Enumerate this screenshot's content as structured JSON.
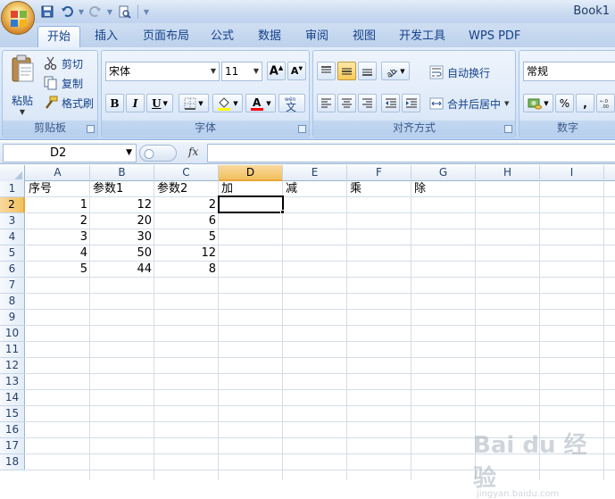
{
  "window": {
    "title": "Book1"
  },
  "tabs": [
    "开始",
    "插入",
    "页面布局",
    "公式",
    "数据",
    "审阅",
    "视图",
    "开发工具",
    "WPS PDF"
  ],
  "active_tab": "开始",
  "ribbon": {
    "clipboard": {
      "paste": "粘贴",
      "cut": "剪切",
      "copy": "复制",
      "format_painter": "格式刷",
      "label": "剪贴板"
    },
    "font": {
      "name": "宋体",
      "size": "11",
      "label": "字体",
      "bold": "B",
      "italic": "I",
      "underline": "U",
      "phonetic": "wén"
    },
    "alignment": {
      "wrap_text": "自动换行",
      "merge_center": "合并后居中",
      "label": "对齐方式"
    },
    "number": {
      "format": "常规",
      "percent": "%",
      "comma": ",",
      "label": "数字"
    }
  },
  "formula_bar": {
    "name_box": "D2",
    "fx": "fx",
    "formula": ""
  },
  "columns": [
    "A",
    "B",
    "C",
    "D",
    "E",
    "F",
    "G",
    "H",
    "I"
  ],
  "selected_column": "D",
  "rows": [
    "1",
    "2",
    "3",
    "4",
    "5",
    "6",
    "7",
    "8",
    "9",
    "10",
    "11",
    "12",
    "13",
    "14",
    "15",
    "16",
    "17",
    "18"
  ],
  "selected_row": "2",
  "sheet": {
    "header": [
      "序号",
      "参数1",
      "参数2",
      "加",
      "减",
      "乘",
      "除"
    ],
    "data": [
      [
        "1",
        "12",
        "2"
      ],
      [
        "2",
        "20",
        "6"
      ],
      [
        "3",
        "30",
        "5"
      ],
      [
        "4",
        "50",
        "12"
      ],
      [
        "5",
        "44",
        "8"
      ]
    ]
  },
  "watermark": {
    "text": "Bai du 经验",
    "sub": "jingyan.baidu.com"
  }
}
